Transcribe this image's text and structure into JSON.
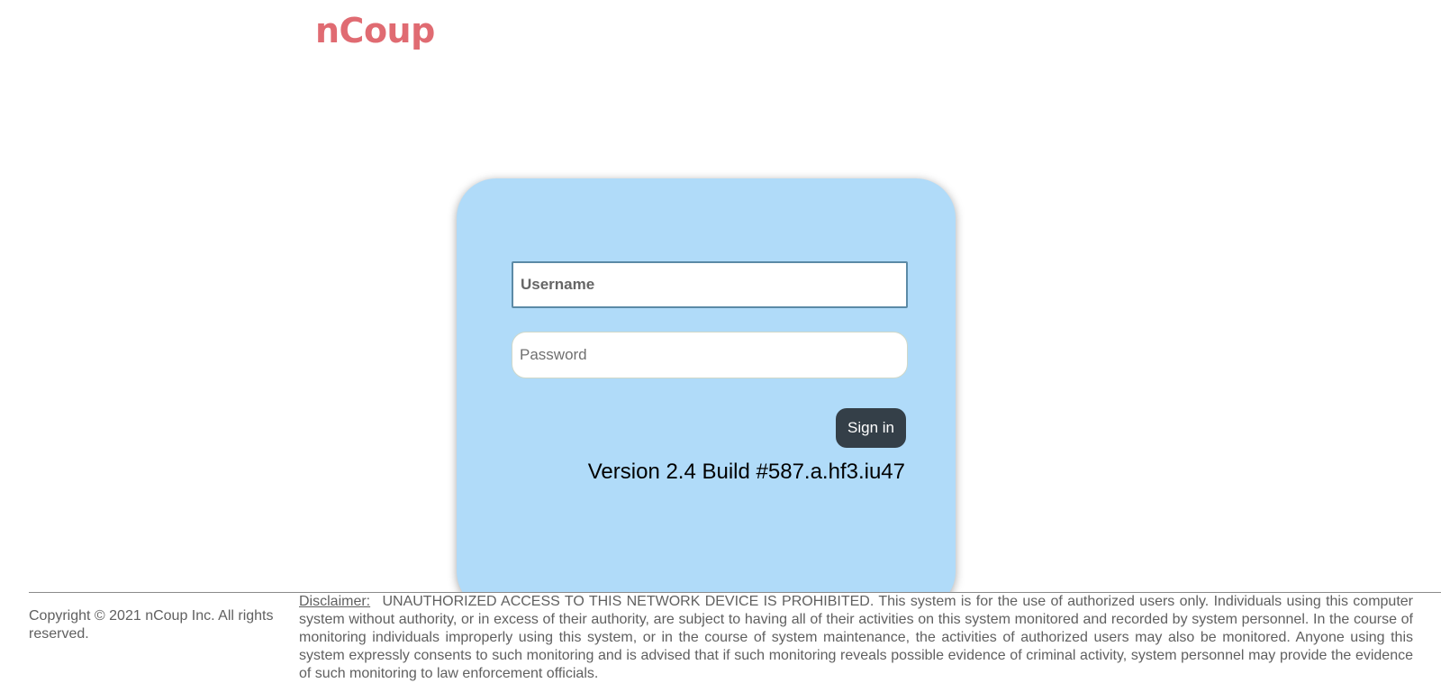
{
  "brand": {
    "logo_text": "nCoup",
    "logo_color": "#e06b72"
  },
  "login": {
    "username_placeholder": "Username",
    "password_placeholder": "Password",
    "signin_label": "Sign in",
    "version": "Version 2.4 Build #587.a.hf3.iu47",
    "card_color": "#b0dbf9",
    "button_color": "#343f48"
  },
  "footer": {
    "copyright": "Copyright © 2021 nCoup Inc. All rights reserved.",
    "disclaimer_label": "Disclaimer:",
    "disclaimer_text": "UNAUTHORIZED ACCESS TO THIS NETWORK DEVICE IS PROHIBITED.  This system is for the use of authorized users only. Individuals using this computer system without authority, or in excess of their authority, are subject to having all of their activities on this system monitored and recorded by system personnel. In the course of monitoring individuals improperly using this system, or in the course of system maintenance, the activities of authorized users may also be monitored. Anyone using this system expressly consents to such monitoring and is advised that if such monitoring reveals possible evidence of criminal activity, system personnel may provide the evidence of such monitoring to law enforcement officials."
  }
}
